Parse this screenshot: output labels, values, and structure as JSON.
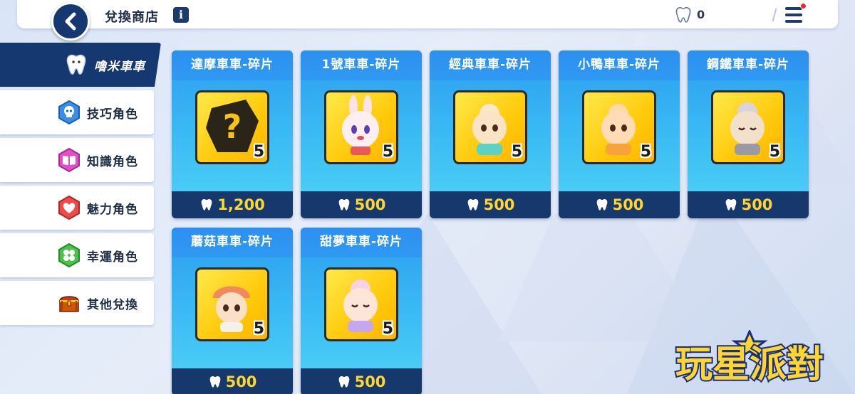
{
  "header": {
    "title": "兌換商店",
    "info_icon": "i",
    "currency_icon": "tooth-icon",
    "currency_value": "0"
  },
  "sidebar": {
    "items": [
      {
        "label": "嚕米車車",
        "icon": "tooth-icon",
        "active": true
      },
      {
        "label": "技巧角色",
        "icon": "skull-hexagon-icon",
        "active": false
      },
      {
        "label": "知識角色",
        "icon": "book-hexagon-icon",
        "active": false
      },
      {
        "label": "魅力角色",
        "icon": "heart-hexagon-icon",
        "active": false
      },
      {
        "label": "幸運角色",
        "icon": "clover-hexagon-icon",
        "active": false
      },
      {
        "label": "其他兌換",
        "icon": "treasure-chest-icon",
        "active": false
      }
    ]
  },
  "shop": {
    "items": [
      {
        "name": "達摩車車-碎片",
        "quantity": "5",
        "price": "1,200",
        "icon": "mystery-question-icon"
      },
      {
        "name": "1號車車-碎片",
        "quantity": "5",
        "price": "500",
        "icon": "bunny-character-icon"
      },
      {
        "name": "經典車車-碎片",
        "quantity": "5",
        "price": "500",
        "icon": "teal-character-icon"
      },
      {
        "name": "小鴨車車-碎片",
        "quantity": "5",
        "price": "500",
        "icon": "orange-character-icon"
      },
      {
        "name": "鋼鐵車車-碎片",
        "quantity": "5",
        "price": "500",
        "icon": "sleeping-character-icon"
      },
      {
        "name": "蘑菇車車-碎片",
        "quantity": "5",
        "price": "500",
        "icon": "mushroom-character-icon"
      },
      {
        "name": "甜夢車車-碎片",
        "quantity": "5",
        "price": "500",
        "icon": "dream-character-icon"
      }
    ]
  },
  "logo": {
    "text": "玩星派對"
  },
  "colors": {
    "navy": "#16386d",
    "price_yellow": "#ffd630",
    "card_blue": "#2c9cf0",
    "gold": "#ffc90a"
  }
}
